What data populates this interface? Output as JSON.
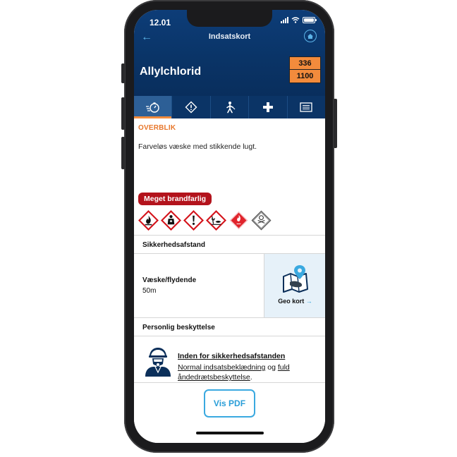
{
  "status_bar": {
    "time": "12.01"
  },
  "nav": {
    "title": "Indsatskort"
  },
  "substance": {
    "name": "Allylchlorid",
    "hazard_id": "336",
    "un_number": "1100"
  },
  "tabs": [
    {
      "id": "overview",
      "icon": "stopwatch-icon",
      "active": true
    },
    {
      "id": "hazards",
      "icon": "warning-diamond-icon",
      "active": false
    },
    {
      "id": "personal",
      "icon": "person-icon",
      "active": false
    },
    {
      "id": "first-aid",
      "icon": "plus-cross-icon",
      "active": false
    },
    {
      "id": "list",
      "icon": "list-icon",
      "active": false
    }
  ],
  "overview": {
    "section_title": "OVERBLIK",
    "description": "Farveløs væske med stikkende lugt.",
    "hazard_badge": "Meget brandfarlig",
    "pictograms": [
      "flame-pictogram",
      "health-hazard-pictogram",
      "exclamation-pictogram",
      "environment-pictogram",
      "flammable-liquid-label",
      "toxic-label"
    ]
  },
  "safety_distance": {
    "title": "Sikkerhedsafstand",
    "state": "Væske/flydende",
    "distance": "50m",
    "geo_link": "Geo kort",
    "geo_arrow": "→"
  },
  "personal_protection": {
    "title": "Personlig beskyttelse",
    "heading": "Inden for sikkerhedsafstanden",
    "text_part1": "Normal indsatsbeklædning",
    "text_part2": " og ",
    "text_part3": "fuld åndedrætsbeskyttelse",
    "text_part4": "."
  },
  "actions": {
    "pdf_label": "Vis PDF"
  },
  "colors": {
    "header": "#0a3467",
    "accent_orange": "#f28b3c",
    "badge_red": "#b3131c",
    "link_blue": "#2a9ed8"
  }
}
